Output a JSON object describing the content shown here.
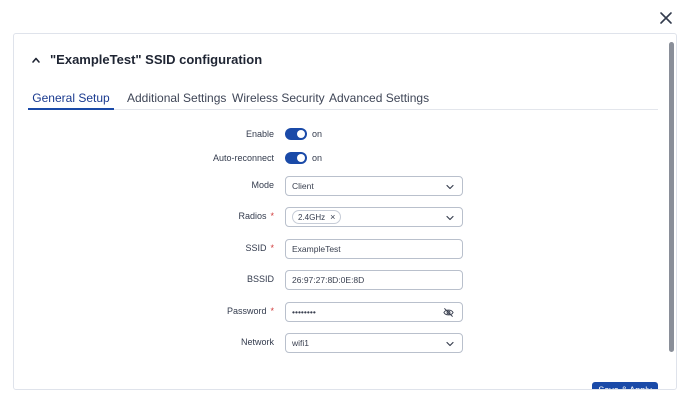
{
  "dialog": {
    "close_icon": "close-icon",
    "section_title": "\"ExampleTest\" SSID configuration",
    "collapse_icon": "chevron-up-icon"
  },
  "tabs": [
    {
      "label": "General Setup",
      "active": true
    },
    {
      "label": "Additional Settings",
      "active": false
    },
    {
      "label": "Wireless Security",
      "active": false
    },
    {
      "label": "Advanced Settings",
      "active": false
    }
  ],
  "form": {
    "enable": {
      "label": "Enable",
      "state": "on"
    },
    "auto_reconnect": {
      "label": "Auto-reconnect",
      "state": "on"
    },
    "mode": {
      "label": "Mode",
      "value": "Client"
    },
    "radios": {
      "label": "Radios",
      "required": "*",
      "chip": "2.4GHz",
      "chip_remove": "×"
    },
    "ssid": {
      "label": "SSID",
      "required": "*",
      "value": "ExampleTest"
    },
    "bssid": {
      "label": "BSSID",
      "value": "26:97:27:8D:0E:8D"
    },
    "password": {
      "label": "Password",
      "required": "*",
      "value": "••••••••",
      "toggle_icon": "eye-off-icon"
    },
    "network": {
      "label": "Network",
      "value": "wifi1"
    }
  },
  "footer": {
    "save_label": "Save & Apply"
  },
  "colors": {
    "accent": "#1a4aa8",
    "required": "#d03a3a",
    "border": "#b9c0cc"
  }
}
